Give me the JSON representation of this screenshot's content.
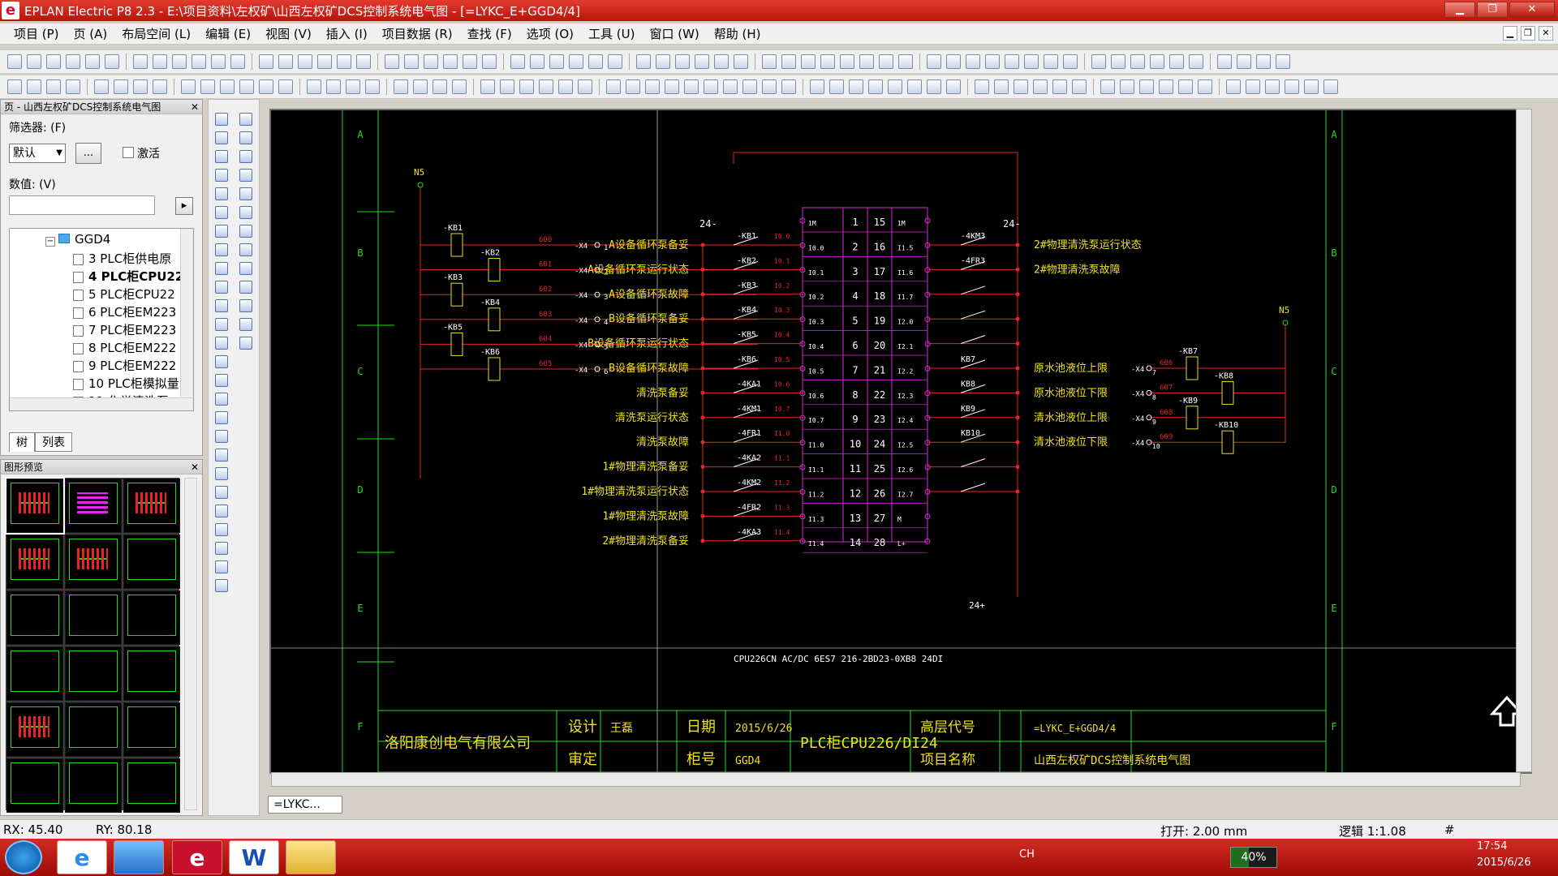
{
  "window": {
    "title": "EPLAN Electric P8 2.3 - E:\\项目资料\\左权矿\\山西左权矿DCS控制系统电气图 - [=LYKC_E+GGD4/4]",
    "logo": "e",
    "controls": {
      "minimize": "▁",
      "restore": "❐",
      "close": "✕"
    }
  },
  "menu": {
    "items": [
      "项目 (P)",
      "页 (A)",
      "布局空间 (L)",
      "编辑 (E)",
      "视图 (V)",
      "插入 (I)",
      "项目数据 (R)",
      "查找 (F)",
      "选项 (O)",
      "工具 (U)",
      "窗口 (W)",
      "帮助 (H)"
    ],
    "mdi": [
      "▁",
      "❐",
      "✕"
    ]
  },
  "page_panel": {
    "title": "页 - 山西左权矿DCS控制系统电气图",
    "close": "✕",
    "filter_label": "筛选器: (F)",
    "filter_value": "默认",
    "more_button": "...",
    "activate_label": "激活",
    "value_label": "数值: (V)",
    "value_input": "",
    "go_button": "▸",
    "tree": {
      "root": "GGD4",
      "items": [
        "3 PLC柜供电原",
        "4 PLC柜CPU22",
        "5 PLC柜CPU22",
        "6 PLC柜EM223",
        "7 PLC柜EM223",
        "8 PLC柜EM222",
        "9 PLC柜EM222",
        "10 PLC柜模拟量",
        "11 化学清洗泵"
      ],
      "selected": 1
    },
    "tabs": [
      "树",
      "列表"
    ]
  },
  "preview_panel": {
    "title": "图形预览",
    "close": "✕"
  },
  "doc_tab": "=LYKC...",
  "status": {
    "rx": "RX: 45.40",
    "ry": "RY: 80.18",
    "open": "打开: 2.00 mm",
    "logic": "逻辑 1:1.08",
    "hash": "#"
  },
  "taskbar": {
    "lang": "CH",
    "battery": "40%",
    "time": "17:54",
    "date": "2015/6/26"
  },
  "schematic": {
    "row_labels": [
      "A",
      "B",
      "C",
      "D",
      "E",
      "F"
    ],
    "left_net": "N5",
    "right_net": "N5",
    "supply": "24-",
    "supply_bottom": "24+",
    "left_relays": [
      "-KB1",
      "-KB2",
      "-KB3",
      "-KB4",
      "-KB5",
      "-KB6"
    ],
    "left_wires": [
      "600",
      "601",
      "602",
      "603",
      "604",
      "605"
    ],
    "left_terms": [
      "-X4",
      "-X4",
      "-X4",
      "-X4",
      "-X4",
      "-X4"
    ],
    "left_term_nums": [
      "1",
      "2",
      "3",
      "4",
      "5",
      "6"
    ],
    "input_labels_left": [
      "A设备循环泵备妥",
      "A设备循环泵运行状态",
      "A设备循环泵故障",
      "B设备循环泵备妥",
      "B设备循环泵运行状态",
      "B设备循环泵故障",
      "清洗泵备妥",
      "清洗泵运行状态",
      "清洗泵故障",
      "1#物理清洗泵备妥",
      "1#物理清洗泵运行状态",
      "1#物理清洗泵故障",
      "2#物理清洗泵备妥"
    ],
    "contacts_left": [
      "-KB1",
      "-KB2",
      "-KB3",
      "-KB4",
      "-KB5",
      "-KB6",
      "-4KA1",
      "-4KM1",
      "-4FR1",
      "-4KA2",
      "-4KM2",
      "-4FR2",
      "-4KA3"
    ],
    "addr_left": [
      "I0.0",
      "I0.1",
      "I0.2",
      "I0.3",
      "I0.4",
      "I0.5",
      "I0.6",
      "I0.7",
      "I1.0",
      "I1.1",
      "I1.2",
      "I1.3",
      "I1.4"
    ],
    "pins_left": [
      "1",
      "2",
      "3",
      "4",
      "5",
      "6",
      "7",
      "8",
      "9",
      "10",
      "11",
      "12",
      "13",
      "14"
    ],
    "pins_right": [
      "15",
      "16",
      "17",
      "18",
      "19",
      "20",
      "21",
      "22",
      "23",
      "24",
      "25",
      "26",
      "27",
      "28"
    ],
    "plc_left_names": [
      "1M",
      "I0.0",
      "I0.1",
      "I0.2",
      "I0.3",
      "I0.4",
      "I0.5",
      "I0.6",
      "I0.7",
      "I1.0",
      "I1.1",
      "I1.2",
      "I1.3",
      "I1.4"
    ],
    "plc_right_names": [
      "1M",
      "I1.5",
      "I1.6",
      "I1.7",
      "I2.0",
      "I2.1",
      "I2.2",
      "I2.3",
      "I2.4",
      "I2.5",
      "I2.6",
      "I2.7",
      "M",
      "L+"
    ],
    "contacts_right": [
      "-4KM3",
      "-4FR3",
      "",
      "",
      "",
      "KB7",
      "KB8",
      "KB9",
      "KB10",
      "",
      ""
    ],
    "input_labels_right": [
      "2#物理清洗泵运行状态",
      "2#物理清洗泵故障",
      "",
      "",
      "",
      "原水池液位上限",
      "原水池液位下限",
      "清水池液位上限",
      "清水池液位下限"
    ],
    "right_relays": [
      "-KB7",
      "-KB8",
      "-KB9",
      "-KB10"
    ],
    "right_wires": [
      "606",
      "607",
      "608",
      "609"
    ],
    "right_term_nums": [
      "7",
      "8",
      "9",
      "10"
    ],
    "plc_model": "CPU226CN AC/DC 6ES7 216-2BD23-0XB8  24DI",
    "titleblock": {
      "company": "洛阳康创电气有限公司",
      "design_label": "设计",
      "designer": "王磊",
      "check_label": "审定",
      "date_label": "日期",
      "date": "2015/6/26",
      "cabinet_label": "柜号",
      "cabinet": "GGD4",
      "drawing_title": "PLC柜CPU226/DI24",
      "code_label": "高层代号",
      "code": "=LYKC_E+GGD4/4",
      "project_label": "项目名称",
      "project": "山西左权矿DCS控制系统电气图"
    }
  },
  "colors": {
    "title_bg": "#c8102e",
    "bg_canvas": "#000000",
    "frame": "#1ee01e",
    "wire": "#e8242a",
    "plc": "#d92ad9",
    "text_label": "#f0e020",
    "contact_text": "#ffffff"
  }
}
